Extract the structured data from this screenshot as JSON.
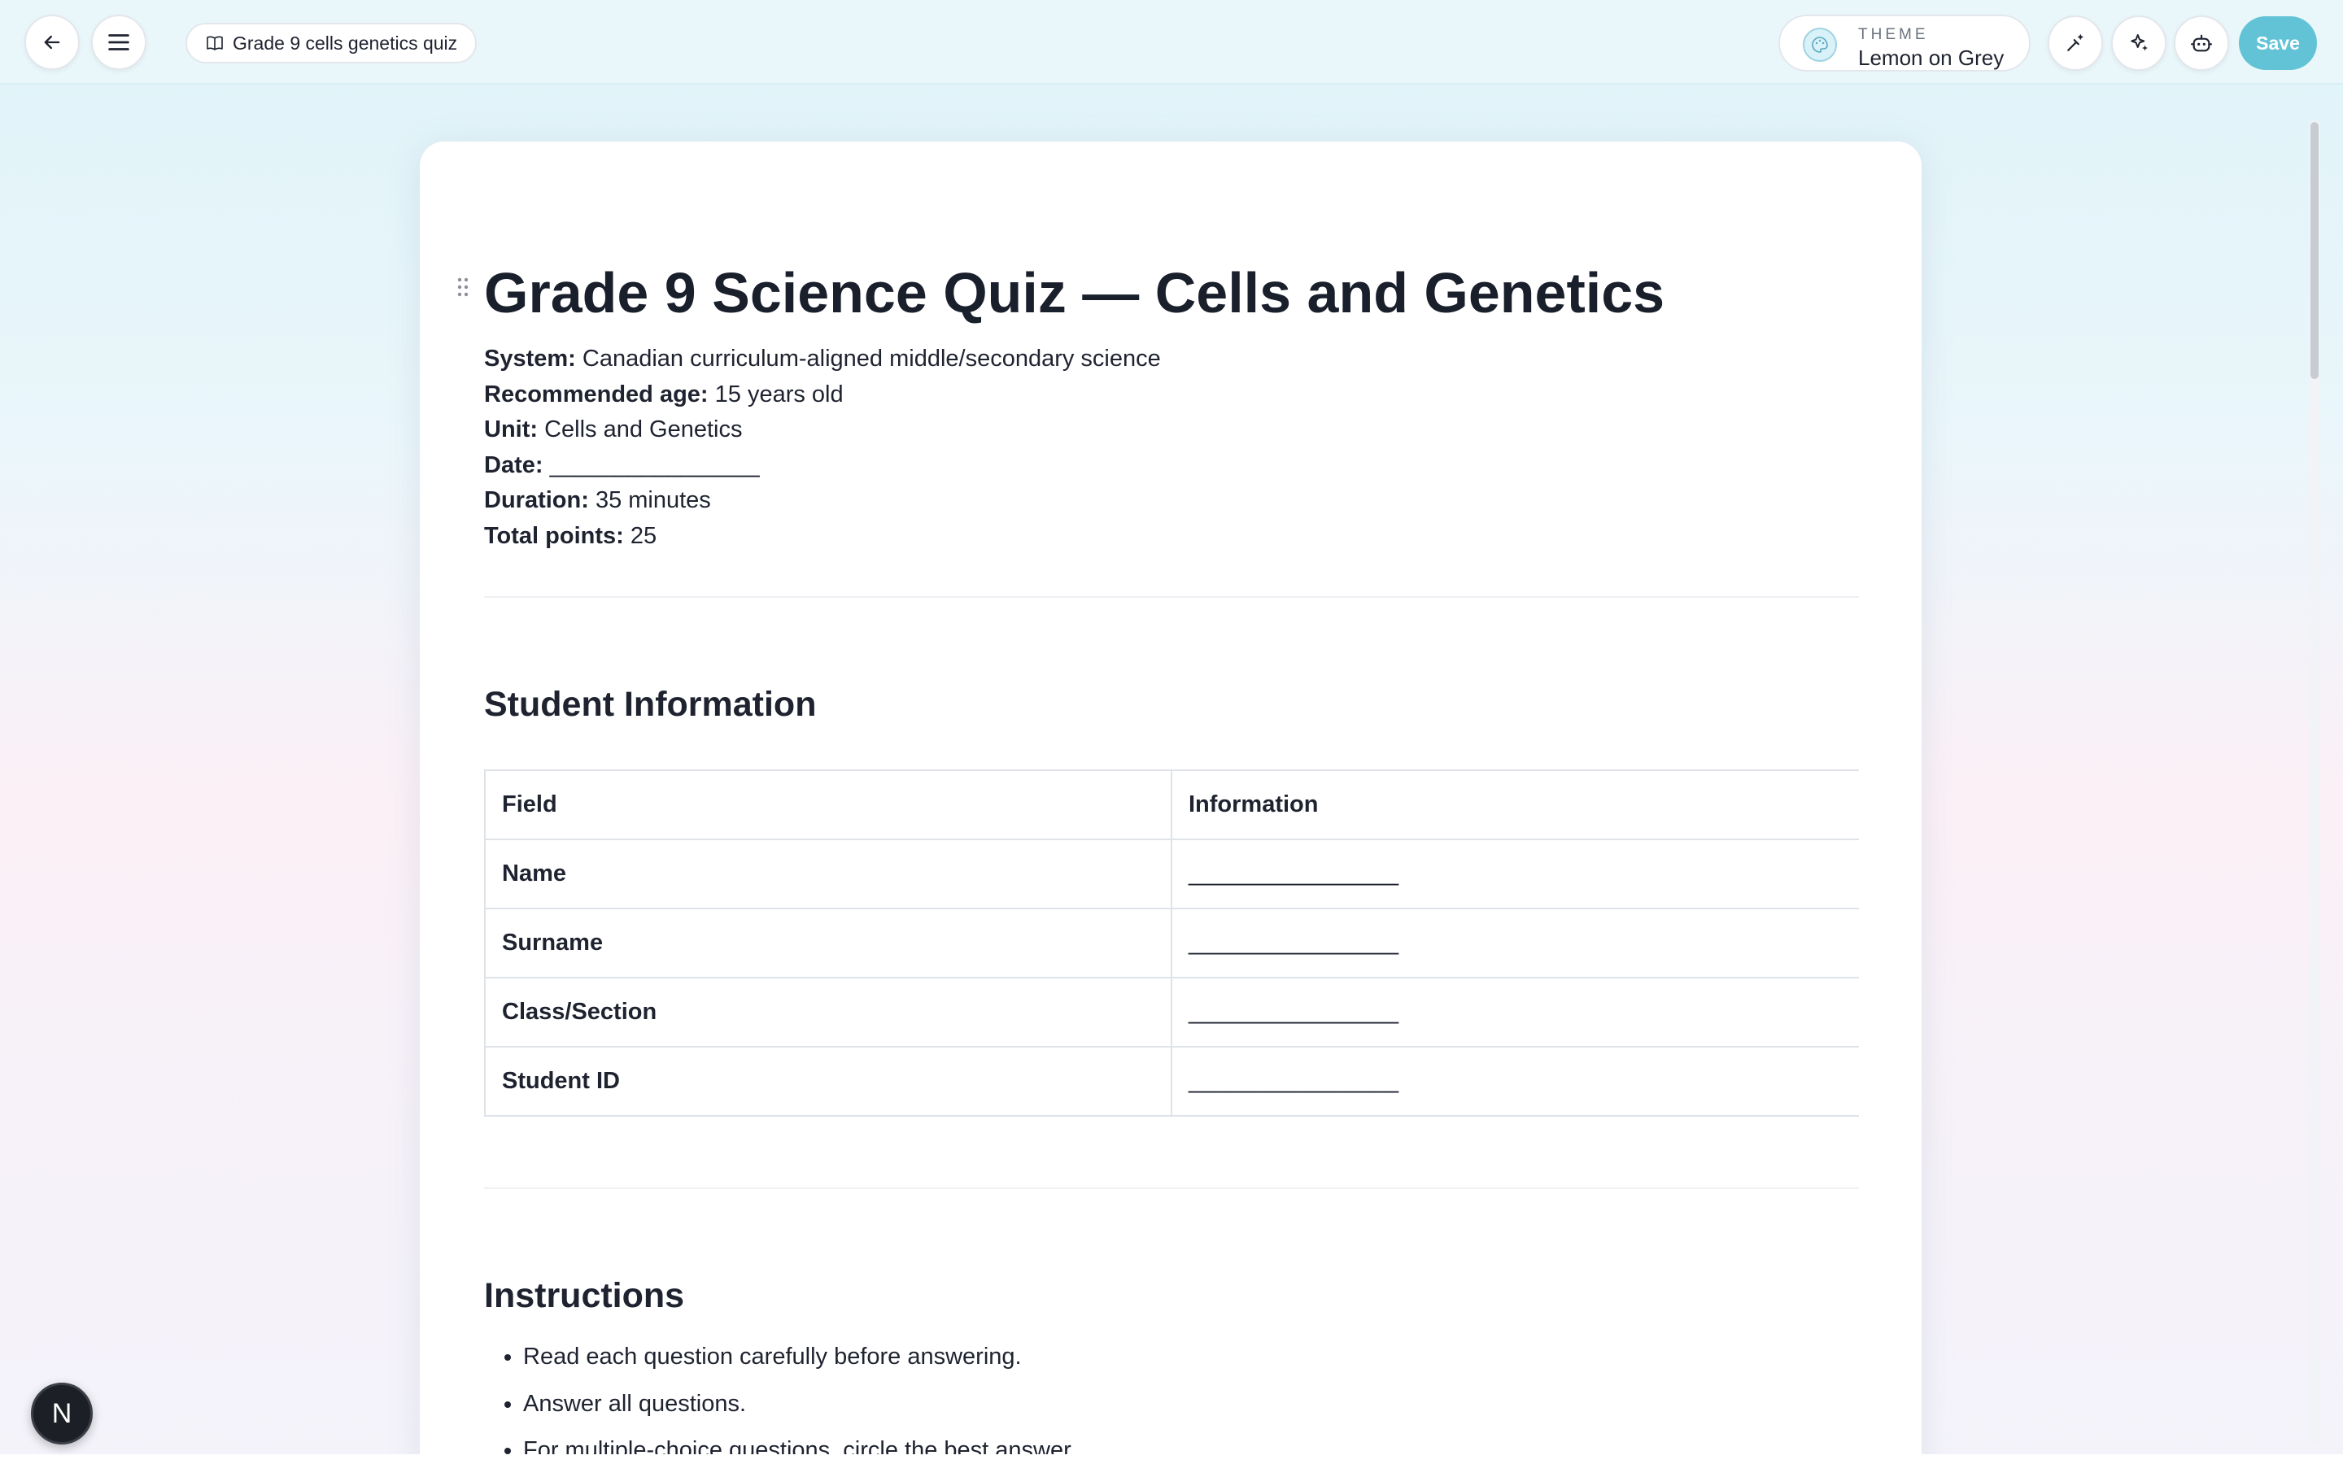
{
  "topbar": {
    "doc_title": "Grade 9 cells genetics quiz",
    "theme_label": "THEME",
    "theme_value": "Lemon on Grey",
    "save_label": "Save"
  },
  "document": {
    "title": "Grade 9 Science Quiz — Cells and Genetics",
    "meta": [
      {
        "label": "System:",
        "value": "Canadian curriculum-aligned middle/secondary science"
      },
      {
        "label": "Recommended age:",
        "value": "15 years old"
      },
      {
        "label": "Unit:",
        "value": "Cells and Genetics"
      },
      {
        "label": "Date:",
        "value": "________________"
      },
      {
        "label": "Duration:",
        "value": "35 minutes"
      },
      {
        "label": "Total points:",
        "value": "25"
      }
    ],
    "student_info": {
      "heading": "Student Information",
      "headers": [
        "Field",
        "Information"
      ],
      "rows": [
        {
          "field": "Name",
          "value": "________________"
        },
        {
          "field": "Surname",
          "value": "________________"
        },
        {
          "field": "Class/Section",
          "value": "________________"
        },
        {
          "field": "Student ID",
          "value": "________________"
        }
      ]
    },
    "instructions": {
      "heading": "Instructions",
      "items": [
        "Read each question carefully before answering.",
        "Answer all questions.",
        "For multiple-choice questions, circle the best answer."
      ]
    }
  },
  "badge": {
    "letter": "N"
  },
  "colors": {
    "accent": "#63c3d6",
    "topbar_bg": "#e9f7fb",
    "text": "#1f2330"
  },
  "icons": [
    "back-arrow-icon",
    "menu-icon",
    "book-icon",
    "palette-icon",
    "sparkle-edit-icon",
    "sparkles-icon",
    "robot-icon",
    "drag-handle-icon"
  ]
}
